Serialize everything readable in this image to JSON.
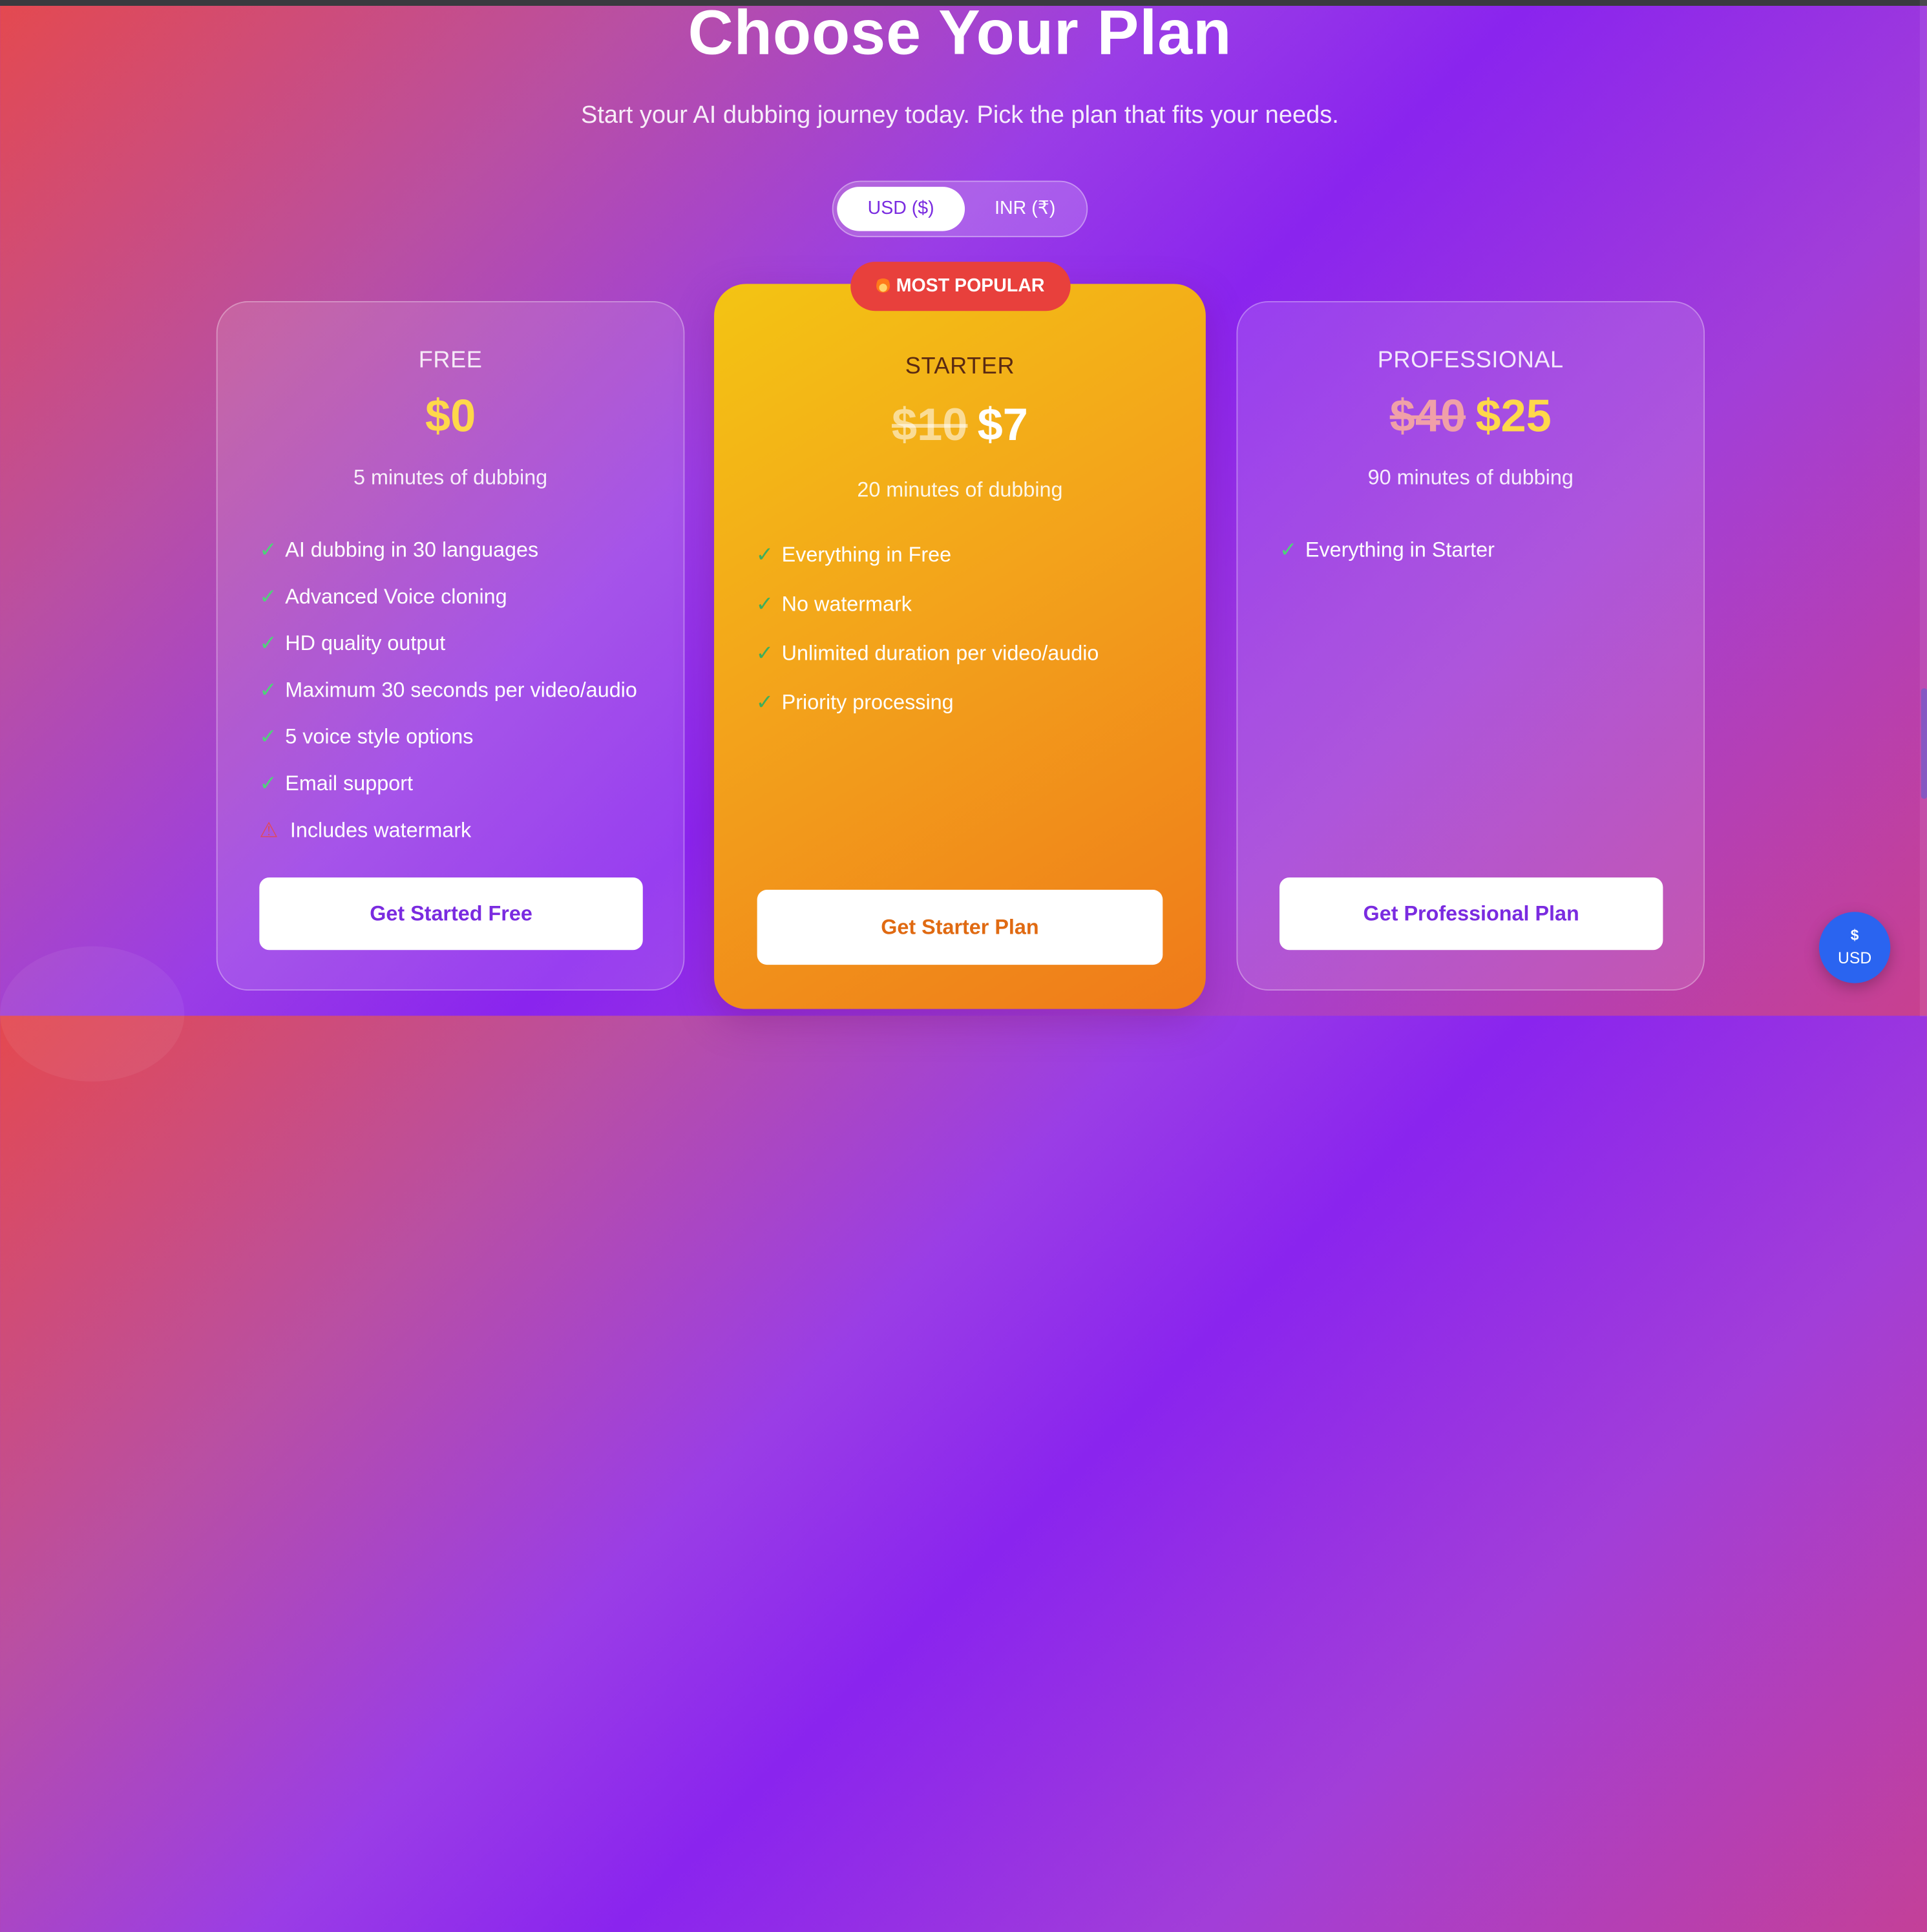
{
  "header": {
    "title": "Choose Your Plan",
    "subtitle": "Start your AI dubbing journey today. Pick the plan that fits your needs."
  },
  "currency_toggle": {
    "options": [
      "USD ($)",
      "INR (₹)"
    ],
    "selected": "USD ($)"
  },
  "plans": [
    {
      "name": "FREE",
      "price": "$0",
      "minutes": "5 minutes of dubbing",
      "features": [
        "AI dubbing in 30 languages",
        "Advanced Voice cloning",
        "HD quality output",
        "Maximum 30 seconds per video/audio",
        "5 voice style options",
        "Email support"
      ],
      "warning": "Includes watermark",
      "cta": "Get Started Free"
    },
    {
      "name": "STARTER",
      "badge": "MOST POPULAR",
      "old_price": "$10",
      "price": "$7",
      "minutes": "20 minutes of dubbing",
      "features": [
        "Everything in Free",
        "No watermark",
        "Unlimited duration per video/audio",
        "Priority processing"
      ],
      "cta": "Get Starter Plan"
    },
    {
      "name": "PROFESSIONAL",
      "old_price": "$40",
      "price": "$25",
      "minutes": "90 minutes of dubbing",
      "features": [
        "Everything in Starter"
      ],
      "cta": "Get Professional Plan"
    }
  ],
  "currency_fab": {
    "symbol": "$",
    "code": "USD"
  },
  "icons": {
    "check": "check-icon",
    "warning": "warning-icon",
    "badge": "flame-icon"
  },
  "colors": {
    "price_highlight": "#ffd84a",
    "starter_gradient": [
      "#f3c413",
      "#ef7a1a"
    ],
    "badge": "#e8403c",
    "fab": "#2a64f0",
    "check": "#4fd27a",
    "warning": "#e04a5a",
    "toggle_active_text": "#7a2be0",
    "starter_cta_text": "#e06a12"
  }
}
